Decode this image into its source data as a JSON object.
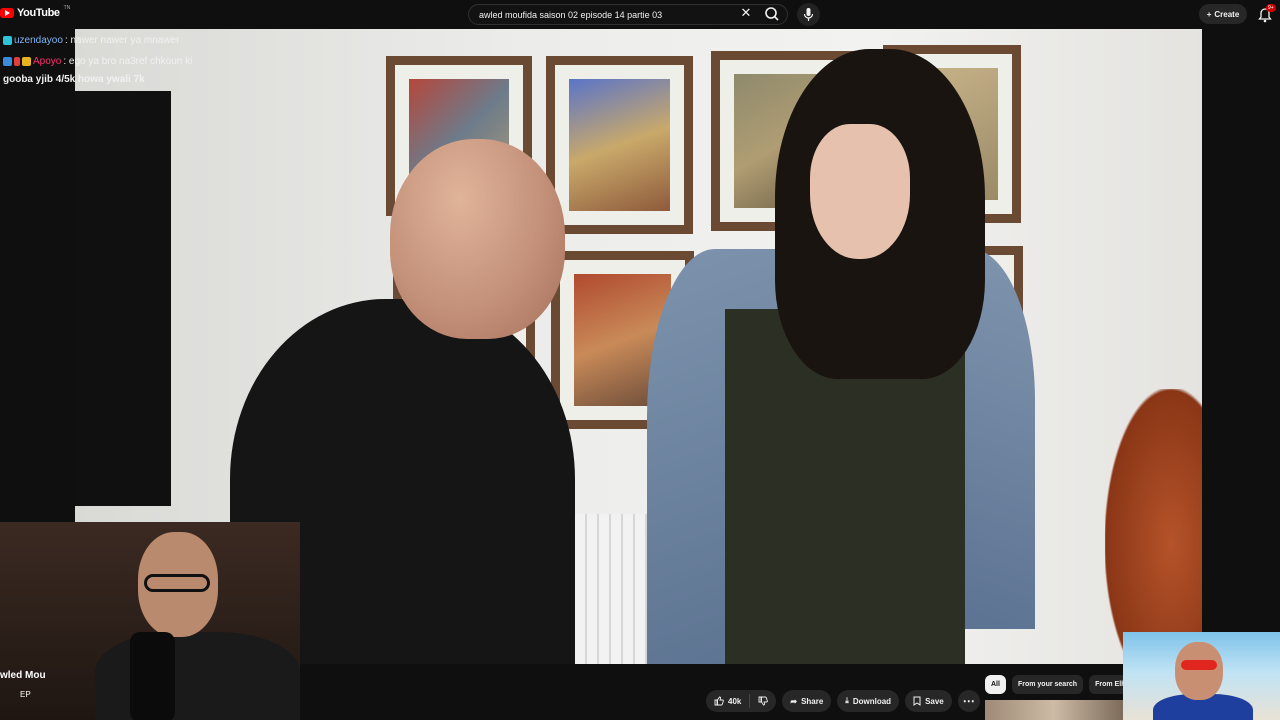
{
  "topbar": {
    "logo_text": "YouTube",
    "logo_sup": "TN",
    "search_value": "awled moufida saison 02 episode 14 partie 03",
    "create_label": "Create",
    "notif_count": "9+"
  },
  "chat": {
    "messages": [
      {
        "user": "uzendayoo",
        "user_color": "#7fb3f2",
        "text": ": nawer nawer ya mnawer"
      },
      {
        "user": "Apoyo",
        "user_color": "#ff2e6a",
        "text": ": ego ya bro na3ref chkoun ki"
      },
      {
        "user": "",
        "user_color": "#ffffff",
        "text": "gooba yjib 4/5k howa ywali 7k"
      }
    ]
  },
  "overlay": {
    "title": "wled Mou",
    "small": "EP"
  },
  "actions": {
    "like_count": "40k",
    "share_label": "Share",
    "download_label": "Download",
    "save_label": "Save"
  },
  "chips": [
    "All",
    "From your search",
    "From Elh"
  ],
  "colors": {
    "accent": "#ff0000",
    "background": "#0f0f0f",
    "pill": "#272727"
  }
}
